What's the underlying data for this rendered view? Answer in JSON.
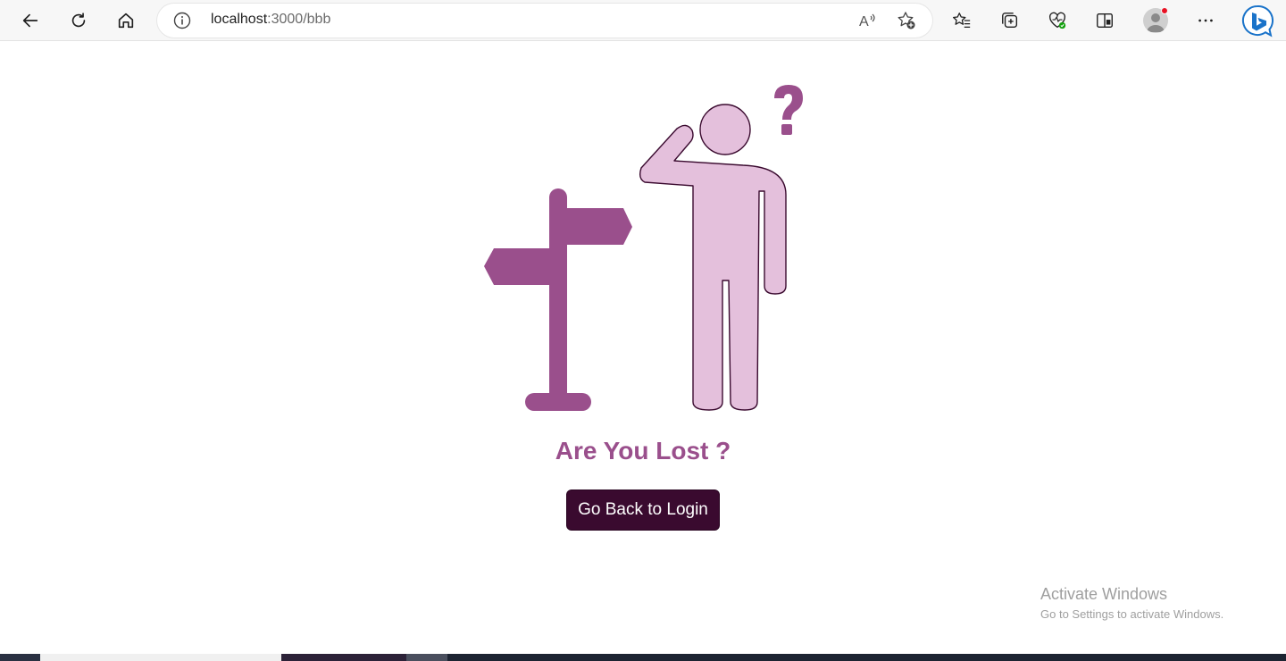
{
  "browser": {
    "url_host": "localhost",
    "url_rest": ":3000/bbb",
    "icons": {
      "back": "back-arrow-icon",
      "refresh": "refresh-icon",
      "home": "home-icon",
      "info": "info-icon",
      "read_aloud": "read-aloud-icon",
      "add_favorite": "add-favorite-icon",
      "favorites": "favorites-icon",
      "collections": "collections-icon",
      "health": "browser-essentials-icon",
      "split": "split-screen-icon",
      "profile": "profile-avatar-icon",
      "more": "more-menu-icon",
      "copilot": "bing-copilot-icon"
    }
  },
  "page": {
    "heading": "Are You Lost ?",
    "button_label": "Go Back to Login",
    "colors": {
      "accent": "#9a4f8c",
      "figure_fill": "#e4c0dc",
      "figure_stroke": "#3a0a2f",
      "button_bg": "#3a0a2f"
    }
  },
  "watermark": {
    "title": "Activate Windows",
    "subtitle": "Go to Settings to activate Windows."
  }
}
